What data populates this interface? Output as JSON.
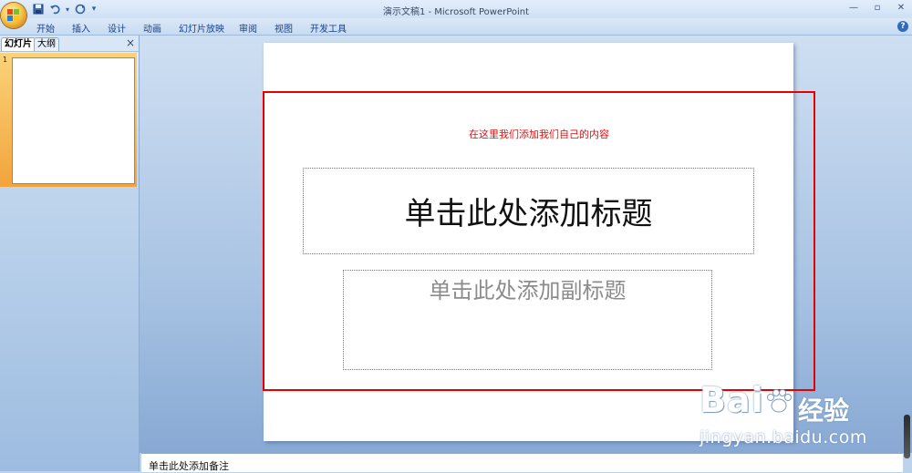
{
  "window": {
    "title": "演示文稿1 - Microsoft PowerPoint",
    "controls": [
      "—",
      "▫",
      "✕"
    ]
  },
  "qat": {
    "save_icon": "save-icon",
    "undo_icon": "undo-icon",
    "redo_icon": "redo-icon",
    "customize_icon": "customize-icon"
  },
  "ribbon": {
    "tabs": [
      "开始",
      "插入",
      "设计",
      "动画",
      "幻灯片放映",
      "审阅",
      "视图",
      "开发工具"
    ]
  },
  "left_panel": {
    "tabs": [
      "幻灯片",
      "大纲"
    ],
    "close": "×",
    "slide_number": "1"
  },
  "slide": {
    "title_placeholder": "单击此处添加标题",
    "subtitle_placeholder": "单击此处添加副标题"
  },
  "annotation": {
    "text": "在这里我们添加我们自己的内容",
    "color": "#e60000"
  },
  "notes": {
    "placeholder": "单击此处添加备注"
  },
  "watermark": {
    "logo": "Bai",
    "logo_tail": "经验",
    "url": "jingyan.baidu.com"
  },
  "colors": {
    "accent": "#15428b",
    "selection": "#f2a43c",
    "highlight": "#e60000"
  }
}
